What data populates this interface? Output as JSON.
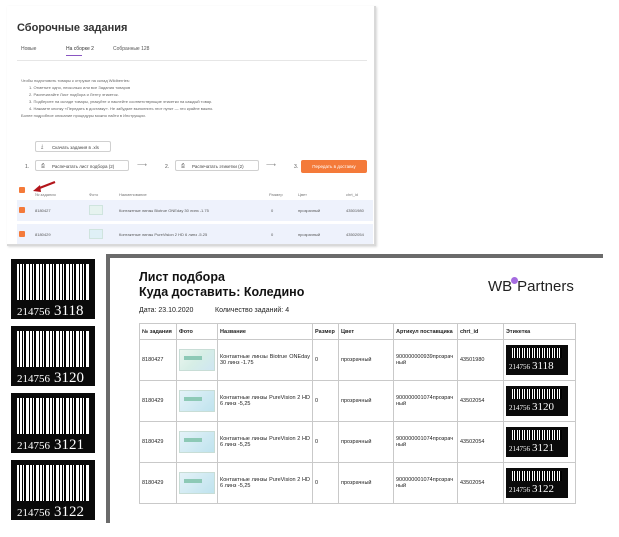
{
  "screenshot": {
    "title": "Сборочные задания",
    "tabs": [
      "Новые",
      "На сборке 2",
      "Собранные 128"
    ],
    "instructions": [
      "Чтобы подготовить товары к отгрузке на склад Wildberries:",
      "1. Отметьте одно, несколько или все Задания товаров",
      "2. Распечатайте Лист подбора и Ленту этикеток.",
      "3. Подберите на складе товары, упакуйте и наклейте соответствующие этикетки на каждый товар.",
      "4. Нажмите кнопку «Передать в доставку». Не забудьте выполнить этот пункт — это крайне важно.",
      "Более подробное описание процедуры можно найти в Инструкции."
    ],
    "download_button": "Скачать задания в .xls",
    "step1_number": "1.",
    "step1_button": "Распечатать лист подбора (2)",
    "step2_number": "2.",
    "step2_button": "Распечатать этикетки (2)",
    "step3_number": "3.",
    "step3_button": "Передать в доставку",
    "arrow_glyph": "⟶",
    "columns": [
      "№ задания",
      "Фото",
      "Наименование",
      "Размер",
      "Цвет",
      "chrt_id"
    ],
    "rows": [
      {
        "id": "8180427",
        "name": "Контактные линзы Biotrue ONEday 30 линз -1.75",
        "size": "0",
        "color": "прозрачный",
        "chrt_id": "43501980"
      },
      {
        "id": "8180429",
        "name": "Контактные линзы PureVision 2 HD 6 линз -5.25",
        "size": "0",
        "color": "прозрачный",
        "chrt_id": "43502054"
      }
    ],
    "colors": {
      "accent": "#f47a3a",
      "tab_underline": "#8a56c2",
      "row_bg": "#eef2fc"
    }
  },
  "labels": [
    {
      "prefix": "214756",
      "suffix": "3118"
    },
    {
      "prefix": "214756",
      "suffix": "3120"
    },
    {
      "prefix": "214756",
      "suffix": "3121"
    },
    {
      "prefix": "214756",
      "suffix": "3122"
    }
  ],
  "sheet": {
    "title_line1": "Лист подбора",
    "title_line2": "Куда доставить: Коледино",
    "logo_left": "WB",
    "logo_right": "Partners",
    "date": "Дата: 23.10.2020",
    "count": "Количество заданий: 4",
    "columns": [
      "№ задания",
      "Фото",
      "Название",
      "Размер",
      "Цвет",
      "Артикул поставщика",
      "chrt_id",
      "Этикетка"
    ],
    "rows": [
      {
        "id": "8180427",
        "name": "Контактные линзы Biotrue ONEday 30 линз -1.75",
        "size": "0",
        "color": "прозрачный",
        "article": "900000000939прозрачный",
        "chrt_id": "43501980",
        "label_prefix": "214756",
        "label_suffix": "3118"
      },
      {
        "id": "8180429",
        "name": "Контактные линзы PureVision 2 HD 6 линз -5,25",
        "size": "0",
        "color": "прозрачный",
        "article": "900000001074прозрачный",
        "chrt_id": "43502054",
        "label_prefix": "214756",
        "label_suffix": "3120"
      },
      {
        "id": "8180429",
        "name": "Контактные линзы PureVision 2 HD 6 линз -5,25",
        "size": "0",
        "color": "прозрачный",
        "article": "900000001074прозрачный",
        "chrt_id": "43502054",
        "label_prefix": "214756",
        "label_suffix": "3121"
      },
      {
        "id": "8180429",
        "name": "Контактные линзы PureVision 2 HD 6 линз -5,25",
        "size": "0",
        "color": "прозрачный",
        "article": "900000001074прозрачный",
        "chrt_id": "43502054",
        "label_prefix": "214756",
        "label_suffix": "3122"
      }
    ],
    "colors": {
      "logo_dot": "#a56be0"
    }
  }
}
